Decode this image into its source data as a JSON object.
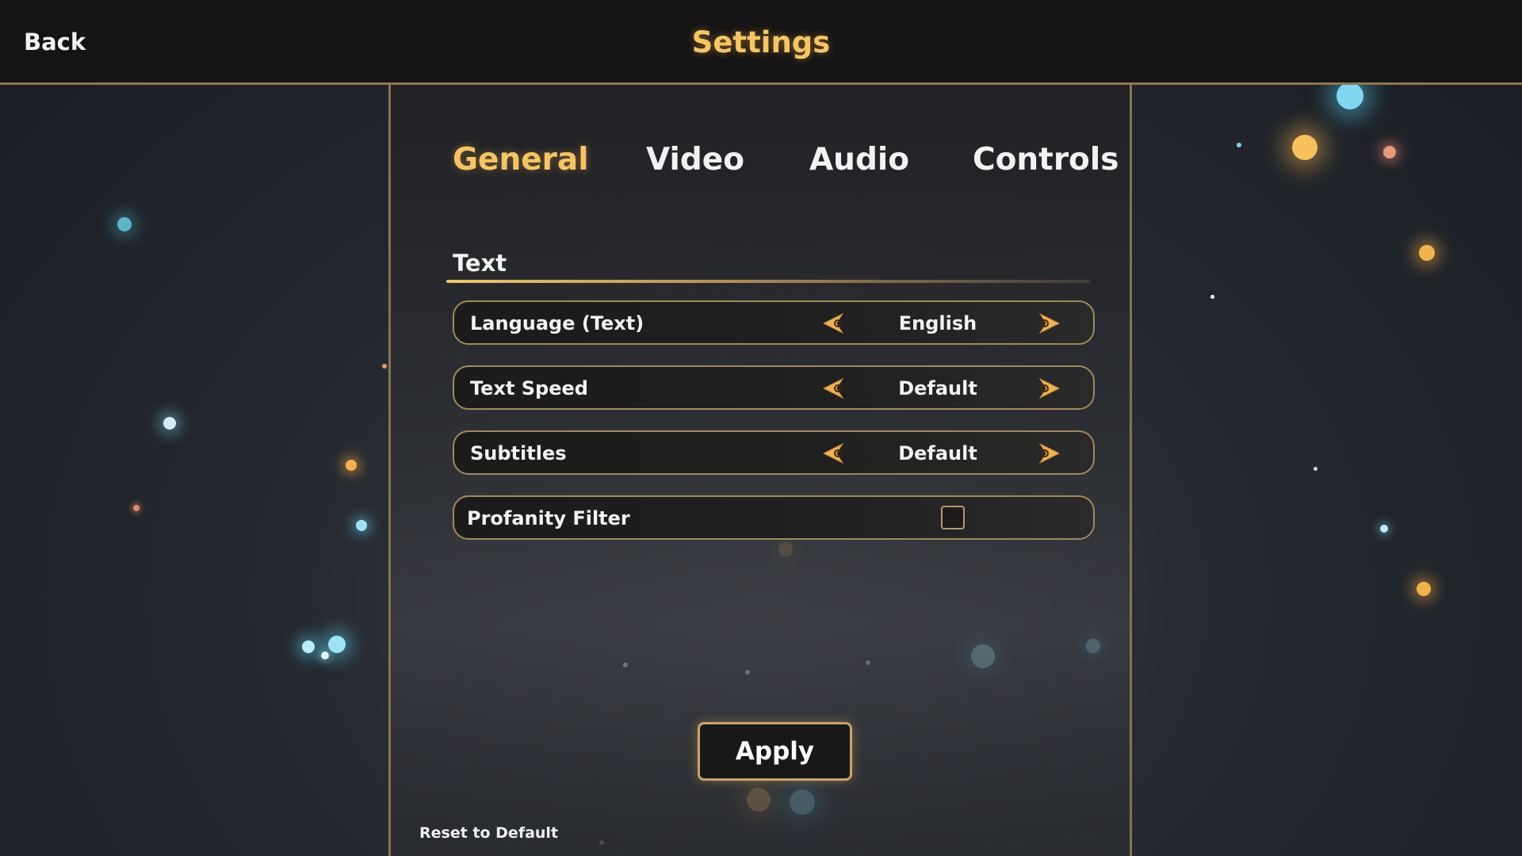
{
  "header": {
    "back_label": "Back",
    "title": "Settings"
  },
  "tabs": [
    {
      "label": "General",
      "active": true
    },
    {
      "label": "Video",
      "active": false
    },
    {
      "label": "Audio",
      "active": false
    },
    {
      "label": "Controls",
      "active": false
    }
  ],
  "section": {
    "title": "Text"
  },
  "settings": [
    {
      "label": "Language (Text)",
      "value": "English",
      "control": "selector"
    },
    {
      "label": "Text Speed",
      "value": "Default",
      "control": "selector"
    },
    {
      "label": "Subtitles",
      "value": "Default",
      "control": "selector"
    },
    {
      "label": "Profanity Filter",
      "checked": false,
      "control": "checkbox"
    }
  ],
  "footer": {
    "apply_label": "Apply",
    "reset_label": "Reset to Default"
  },
  "colors": {
    "accent": "#f6c461",
    "border": "#a38858",
    "bar_background": "#141414"
  },
  "icons": {
    "prev": "arrow-left-icon",
    "next": "arrow-right-icon"
  }
}
